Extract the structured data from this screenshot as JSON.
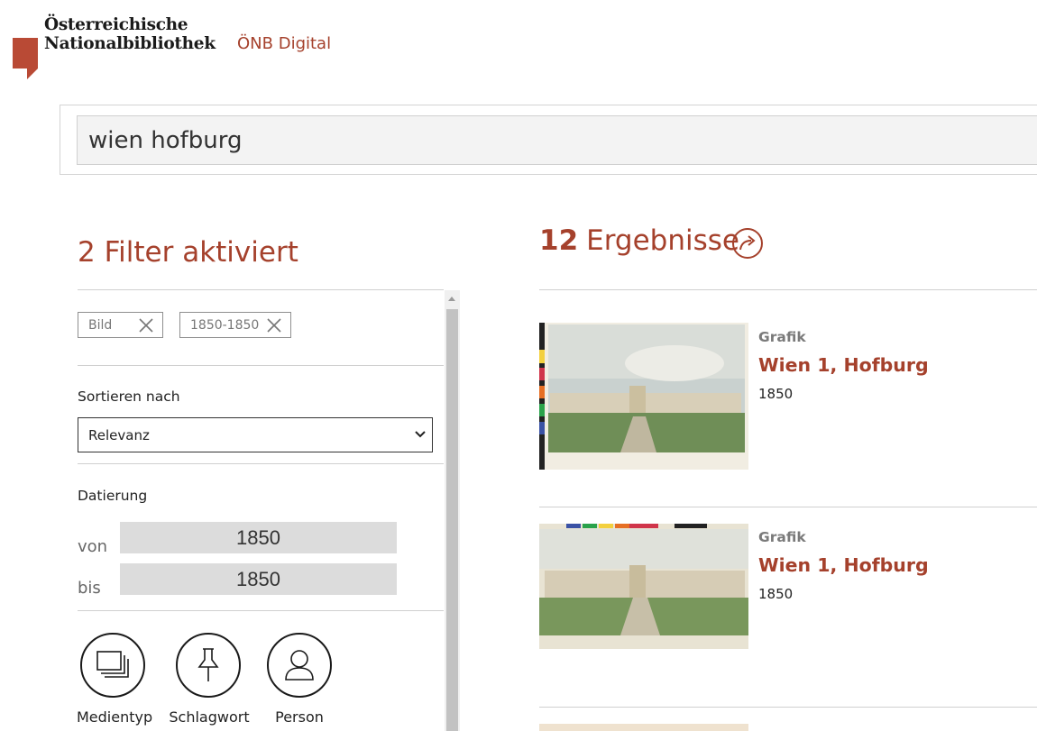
{
  "header": {
    "logo_line1": "Österreichische",
    "logo_line2": "Nationalbibliothek",
    "subbrand": "ÖNB Digital"
  },
  "search": {
    "value": "wien hofburg"
  },
  "filters": {
    "title": "2 Filter aktiviert",
    "chips": [
      {
        "label": "Bild"
      },
      {
        "label": "1850-1850"
      }
    ],
    "sort_label": "Sortieren nach",
    "sort_value": "Relevanz",
    "date_label": "Datierung",
    "from_label": "von",
    "from_value": "1850",
    "to_label": "bis",
    "to_value": "1850",
    "facets": [
      {
        "label": "Medientyp",
        "icon": "stack-icon"
      },
      {
        "label": "Schlagwort",
        "icon": "pin-icon"
      },
      {
        "label": "Person",
        "icon": "person-icon"
      }
    ]
  },
  "results": {
    "count": "12",
    "count_label": "Ergebnisse",
    "items": [
      {
        "type": "Grafik",
        "title": "Wien 1, Hofburg",
        "date": "1850"
      },
      {
        "type": "Grafik",
        "title": "Wien 1, Hofburg",
        "date": "1850"
      }
    ]
  },
  "colors": {
    "accent": "#a5412c",
    "text": "#222222",
    "muted": "#7a7a7a"
  }
}
